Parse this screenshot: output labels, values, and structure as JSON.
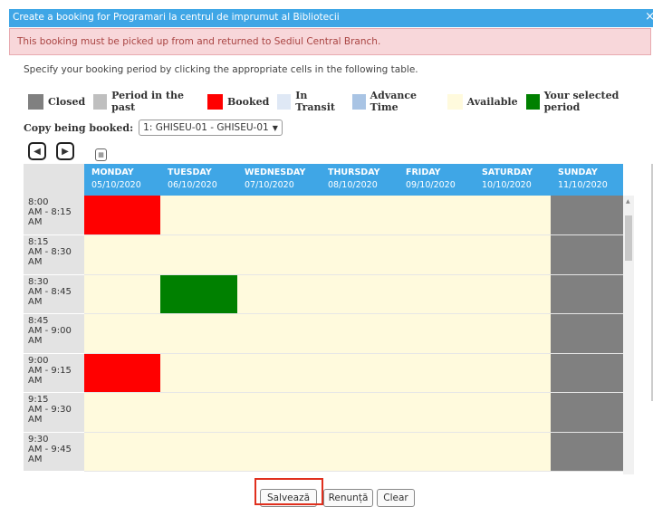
{
  "dialog": {
    "title": "Create a booking for Programari la centrul de imprumut al Bibliotecii",
    "close_glyph": "×",
    "alert": "This booking must be picked up from and returned to Sediul Central Branch.",
    "instructions": "Specify your booking period by clicking the appropriate cells in the following table."
  },
  "legend": [
    {
      "label": "Closed",
      "color": "#808080"
    },
    {
      "label": "Period in the past",
      "color": "#bfbfbf"
    },
    {
      "label": "Booked",
      "color": "#ff0000"
    },
    {
      "label": "In Transit",
      "color": "#dfe8f5"
    },
    {
      "label": "Advance Time",
      "color": "#a9c4e4"
    },
    {
      "label": "Available",
      "color": "#fffadd"
    },
    {
      "label": "Your selected period",
      "color": "#008000"
    }
  ],
  "copy": {
    "label": "Copy being booked:",
    "selected": "1: GHISEU-01 - GHISEU-01"
  },
  "nav": {
    "prev_icon": "◀",
    "next_icon": "▶",
    "calendar_icon": "▦"
  },
  "days": [
    {
      "name": "MONDAY",
      "date": "05/10/2020"
    },
    {
      "name": "TUESDAY",
      "date": "06/10/2020"
    },
    {
      "name": "WEDNESDAY",
      "date": "07/10/2020"
    },
    {
      "name": "THURSDAY",
      "date": "08/10/2020"
    },
    {
      "name": "FRIDAY",
      "date": "09/10/2020"
    },
    {
      "name": "SATURDAY",
      "date": "10/10/2020"
    },
    {
      "name": "SUNDAY",
      "date": "11/10/2020"
    }
  ],
  "slots": [
    {
      "time": "8:00\nAM - 8:15\nAM",
      "cells": [
        "booked",
        "avail",
        "avail",
        "avail",
        "avail",
        "avail",
        "closed"
      ]
    },
    {
      "time": "8:15\nAM - 8:30\nAM",
      "cells": [
        "avail",
        "avail",
        "avail",
        "avail",
        "avail",
        "avail",
        "closed"
      ]
    },
    {
      "time": "8:30\nAM - 8:45\nAM",
      "cells": [
        "avail",
        "sel",
        "avail",
        "avail",
        "avail",
        "avail",
        "closed"
      ]
    },
    {
      "time": "8:45\nAM - 9:00\nAM",
      "cells": [
        "avail",
        "avail",
        "avail",
        "avail",
        "avail",
        "avail",
        "closed"
      ]
    },
    {
      "time": "9:00\nAM - 9:15\nAM",
      "cells": [
        "booked",
        "avail",
        "avail",
        "avail",
        "avail",
        "avail",
        "closed"
      ]
    },
    {
      "time": "9:15\nAM - 9:30\nAM",
      "cells": [
        "avail",
        "avail",
        "avail",
        "avail",
        "avail",
        "avail",
        "closed"
      ]
    },
    {
      "time": "9:30\nAM - 9:45\nAM",
      "cells": [
        "avail",
        "avail",
        "avail",
        "avail",
        "avail",
        "avail",
        "closed"
      ]
    }
  ],
  "buttons": {
    "save": "Salvează",
    "cancel": "Renunță",
    "clear": "Clear"
  }
}
